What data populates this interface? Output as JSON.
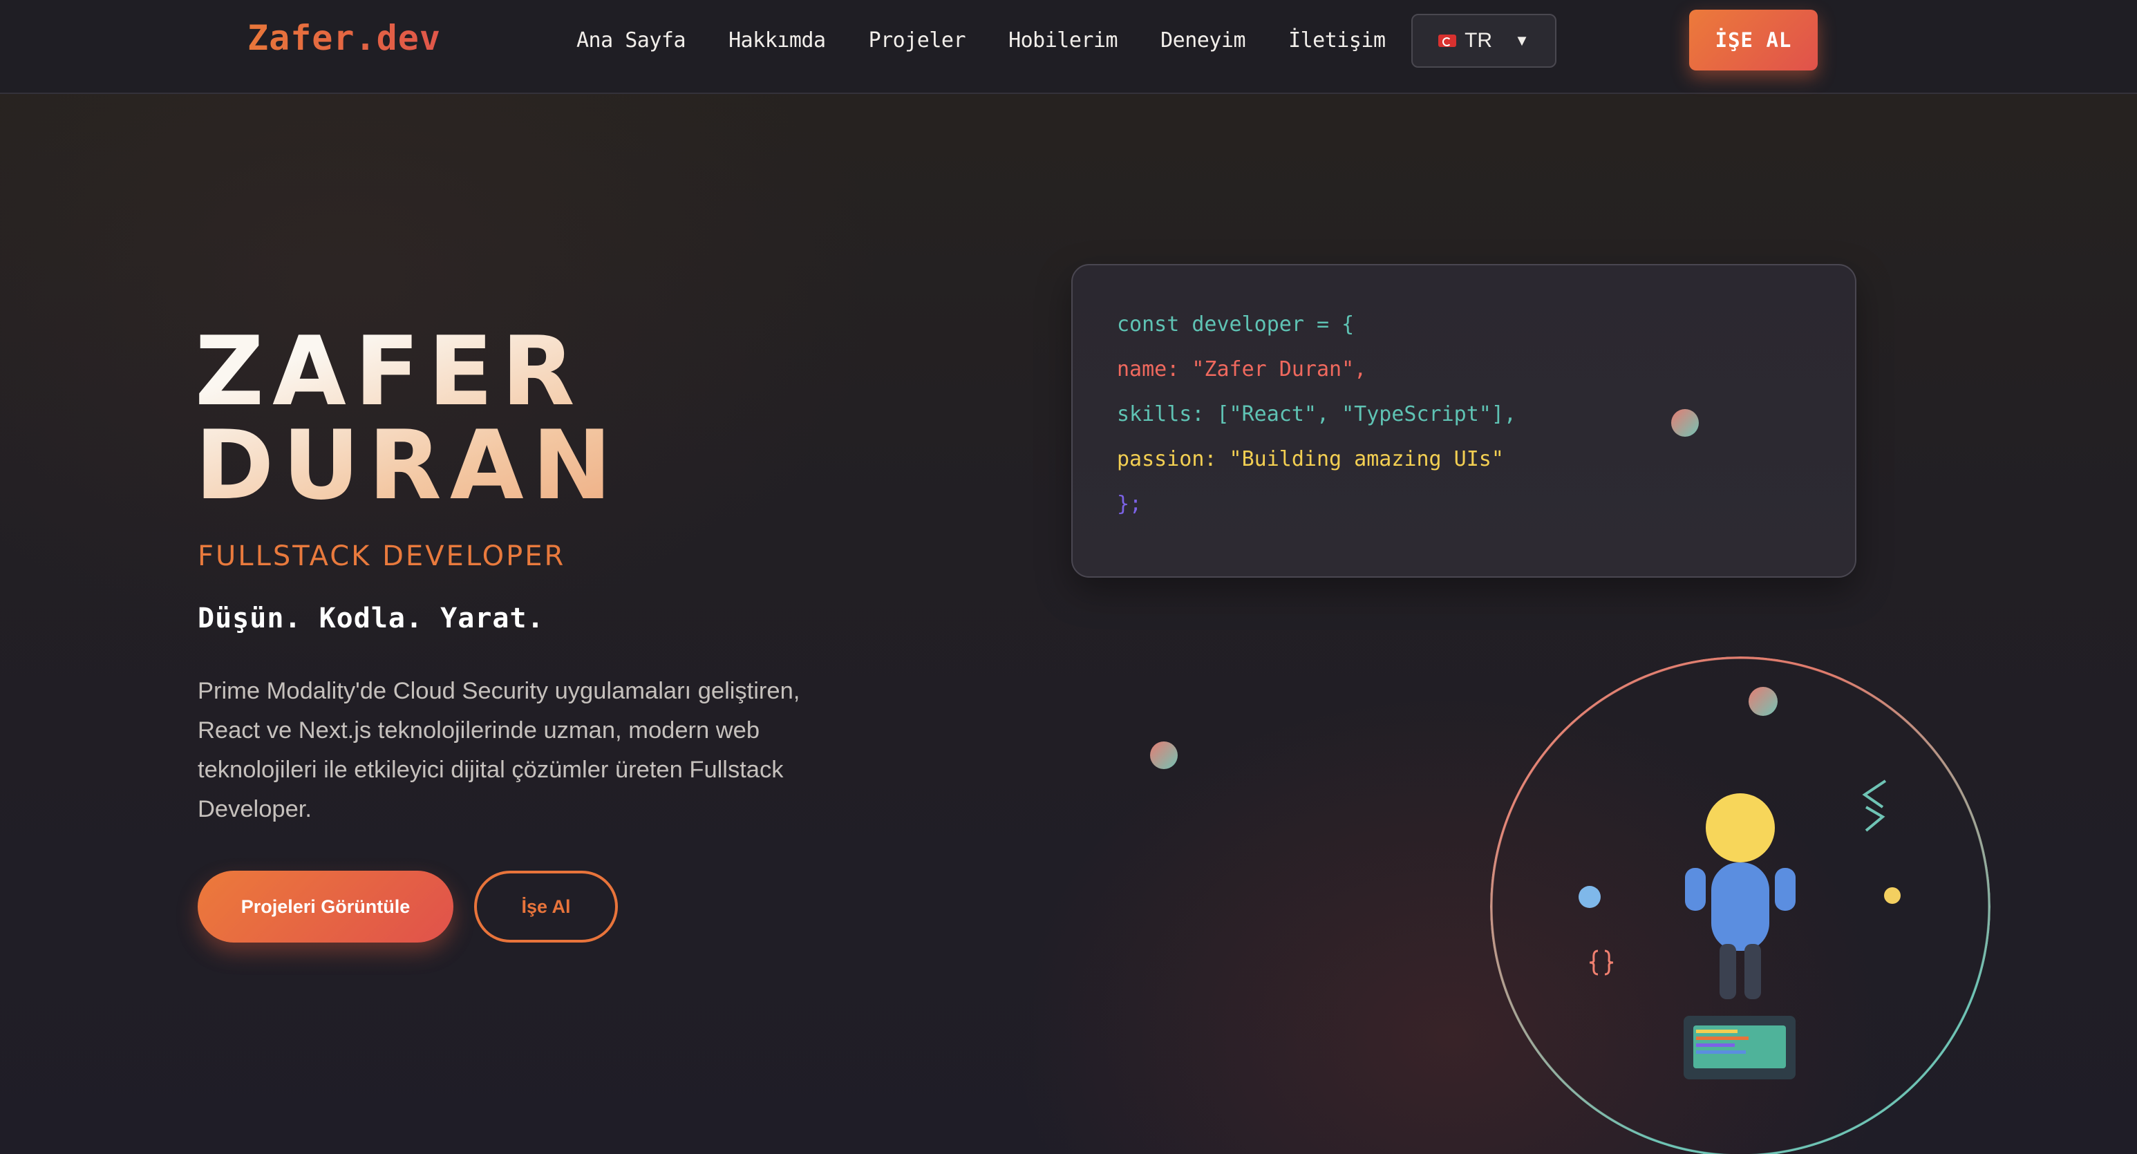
{
  "nav": {
    "logo": "Zafer.dev",
    "links": [
      "Ana Sayfa",
      "Hakkımda",
      "Projeler",
      "Hobilerim",
      "Deneyim",
      "İletişim"
    ],
    "language": {
      "flag_icon": "turkey-flag-icon",
      "label": "TR",
      "caret": "▼"
    },
    "hire_label": "İŞE AL"
  },
  "hero": {
    "first_name": "ZAFER",
    "last_name": "DURAN",
    "role": "FULLSTACK DEVELOPER",
    "tagline": "Düşün. Kodla. Yarat.",
    "description": "Prime Modality'de Cloud Security uygulamaları geliştiren, React ve Next.js teknolojilerinde uzman, modern web teknolojileri ile etkileyici dijital çözümler üreten Fullstack Developer.",
    "primary_button": "Projeleri Görüntüle",
    "secondary_button": "İşe Al"
  },
  "code_card": {
    "lines": [
      "const developer = {",
      "name: \"Zafer Duran\",",
      "skills: [\"React\", \"TypeScript\"],",
      "passion: \"Building amazing UIs\"",
      "};"
    ]
  },
  "illustration": {
    "icons": [
      "code-brackets-icon",
      "curly-braces-icon",
      "developer-figure-icon",
      "laptop-icon"
    ]
  },
  "colors": {
    "accent": "#e8743b",
    "accent_end": "#e0524b",
    "background": "#201e25",
    "code_teal": "#5fc3b4",
    "code_red": "#f0695e",
    "code_yellow": "#f3cf52",
    "code_purple": "#7b62e6"
  }
}
